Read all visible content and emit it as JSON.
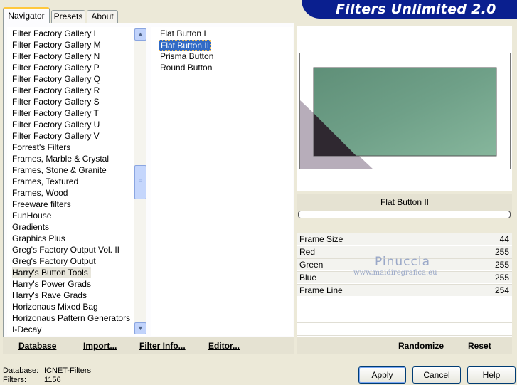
{
  "tabs": [
    "Navigator",
    "Presets",
    "About"
  ],
  "app_title": "Filters Unlimited 2.0",
  "categories": [
    "Filter Factory Gallery L",
    "Filter Factory Gallery M",
    "Filter Factory Gallery N",
    "Filter Factory Gallery P",
    "Filter Factory Gallery Q",
    "Filter Factory Gallery R",
    "Filter Factory Gallery S",
    "Filter Factory Gallery T",
    "Filter Factory Gallery U",
    "Filter Factory Gallery V",
    "Forrest's Filters",
    "Frames, Marble & Crystal",
    "Frames, Stone & Granite",
    "Frames, Textured",
    "Frames, Wood",
    "Freeware filters",
    "FunHouse",
    "Gradients",
    "Graphics Plus",
    "Greg's Factory Output Vol. II",
    "Greg's Factory Output",
    "Harry's Button Tools",
    "Harry's Power Grads",
    "Harry's Rave Grads",
    "Horizonaus Mixed Bag",
    "Horizonaus Pattern Generators",
    "I-Decay"
  ],
  "selected_category": "Harry's Button Tools",
  "filters": [
    "Flat Button I",
    "Flat Button II",
    "Prisma Button",
    "Round Button"
  ],
  "selected_filter": "Flat Button II",
  "filter_title": "Flat Button II",
  "params": [
    {
      "name": "Frame Size",
      "value": "44"
    },
    {
      "name": "Red",
      "value": "255"
    },
    {
      "name": "Green",
      "value": "255"
    },
    {
      "name": "Blue",
      "value": "255"
    },
    {
      "name": "Frame Line",
      "value": "254"
    }
  ],
  "watermark": {
    "name": "Pinuccia",
    "url": "www.maidiregrafica.eu"
  },
  "toolbar_left": [
    "Database",
    "Import...",
    "Filter Info...",
    "Editor..."
  ],
  "toolbar_right": [
    "Randomize",
    "Reset"
  ],
  "status": {
    "database_label": "Database:",
    "database_value": "ICNET-Filters",
    "filters_label": "Filters:",
    "filters_value": "1156"
  },
  "buttons": {
    "apply": "Apply",
    "cancel": "Cancel",
    "help": "Help"
  },
  "colors": {
    "banner": "#0a1f8f",
    "selection": "#316ac5",
    "preview_green": "#6fa088"
  }
}
